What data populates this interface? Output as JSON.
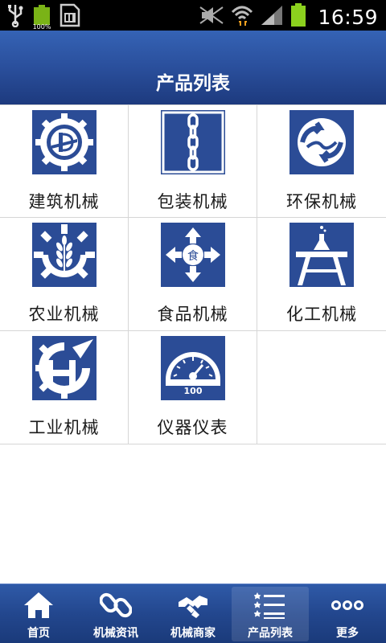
{
  "status_bar": {
    "time": "16:59",
    "battery_small_percent": "100%",
    "icons": [
      "usb-icon",
      "battery-full-icon",
      "sd-card-icon",
      "mute-icon",
      "wifi-icon",
      "signal-icon",
      "battery-charging-icon"
    ]
  },
  "header": {
    "title": "产品列表"
  },
  "categories": [
    {
      "label": "建筑机械",
      "icon": "construction-gear-icon"
    },
    {
      "label": "包装机械",
      "icon": "chain-icon"
    },
    {
      "label": "环保机械",
      "icon": "recycle-icon"
    },
    {
      "label": "农业机械",
      "icon": "wheat-gear-icon"
    },
    {
      "label": "食品机械",
      "icon": "food-arrows-icon"
    },
    {
      "label": "化工机械",
      "icon": "flask-table-icon"
    },
    {
      "label": "工业机械",
      "icon": "industrial-h-icon"
    },
    {
      "label": "仪器仪表",
      "icon": "gauge-icon"
    }
  ],
  "gauge_value": "100",
  "food_glyph": "食",
  "tabs": [
    {
      "label": "首页",
      "icon": "home-icon",
      "active": false
    },
    {
      "label": "机械资讯",
      "icon": "link-icon",
      "active": false
    },
    {
      "label": "机械商家",
      "icon": "handshake-icon",
      "active": false
    },
    {
      "label": "产品列表",
      "icon": "list-icon",
      "active": true
    },
    {
      "label": "更多",
      "icon": "more-icon",
      "active": false
    }
  ],
  "colors": {
    "icon_bg": "#2b4c96",
    "header": "#2a4f9c",
    "tabbar": "#23478e"
  }
}
